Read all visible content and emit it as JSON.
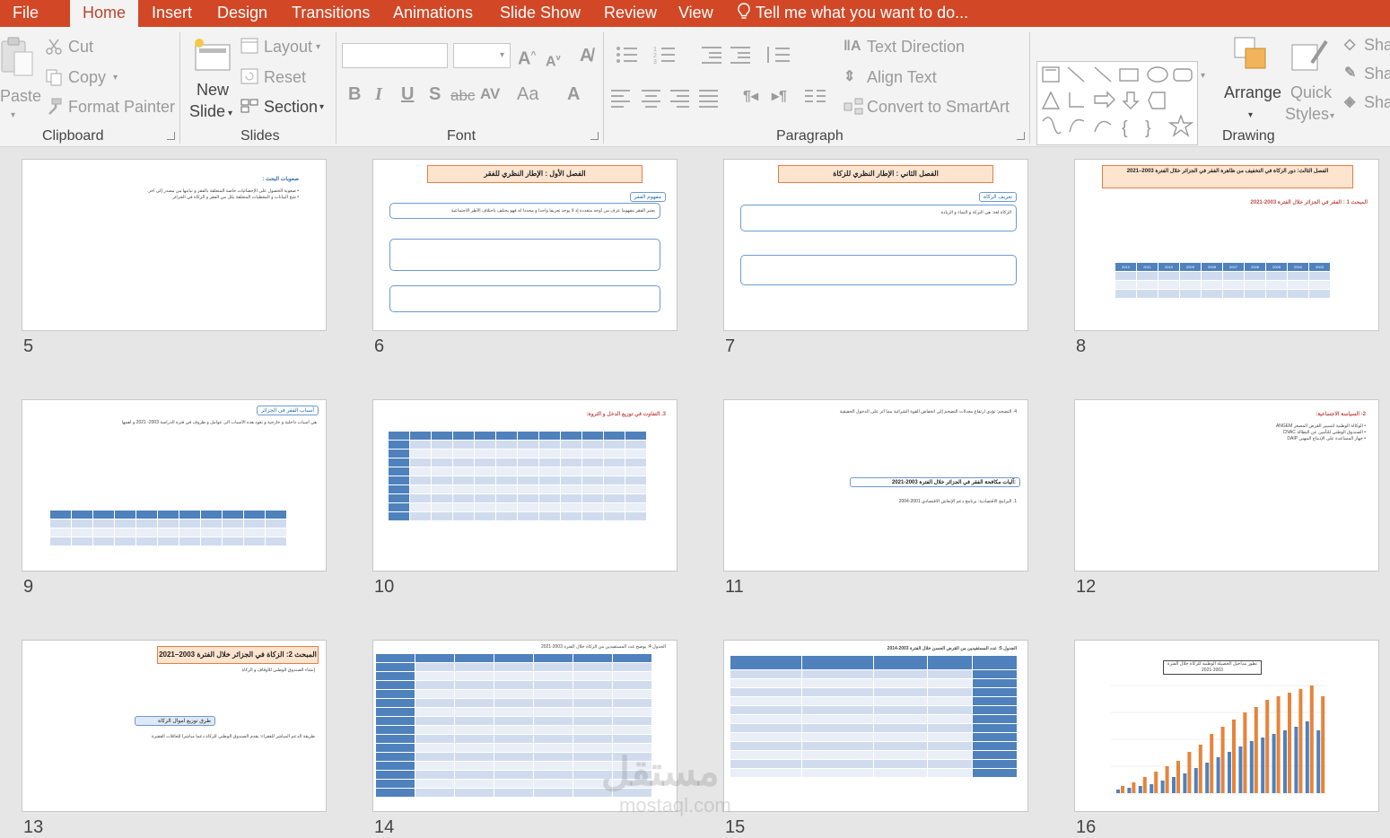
{
  "tabs": [
    "File",
    "Home",
    "Insert",
    "Design",
    "Transitions",
    "Animations",
    "Slide Show",
    "Review",
    "View"
  ],
  "tell_me": "Tell me what you want to do...",
  "clipboard": {
    "paste": "Paste",
    "cut": "Cut",
    "copy": "Copy",
    "format_painter": "Format Painter",
    "label": "Clipboard"
  },
  "slides_group": {
    "new_slide_line1": "New",
    "new_slide_line2": "Slide",
    "layout": "Layout",
    "reset": "Reset",
    "section": "Section",
    "label": "Slides"
  },
  "font_group": {
    "label": "Font"
  },
  "paragraph_group": {
    "text_direction": "Text Direction",
    "align_text": "Align Text",
    "convert_smartart": "Convert to SmartArt",
    "label": "Paragraph"
  },
  "drawing_group": {
    "arrange": "Arrange",
    "quick_styles_line1": "Quick",
    "quick_styles_line2": "Styles",
    "shape_fill": "Sha",
    "shape_outline": "Sha",
    "shape_effects": "Sha",
    "label": "Drawing"
  },
  "slides": [
    {
      "num": "5",
      "title": "",
      "sub": "صعوبات البحث :"
    },
    {
      "num": "6",
      "title": "الفصل الأول : الإطار النظري للفقر",
      "sub": "مفهوم الفقر"
    },
    {
      "num": "7",
      "title": "الفصل الثاني : الإطار النظري للزكاة",
      "sub": "تعريف الزكاة"
    },
    {
      "num": "8",
      "title": "الفصل الثالث: دور الزكاة في التخفيف من ظاهرة الفقر في الجزائر خلال الفترة 2003–2021",
      "sub": "المبحث 1 : الفقر في الجزائر خلال الفترة 2003-2021"
    },
    {
      "num": "9",
      "title": "",
      "sub": "أسباب الفقر في الجزائر"
    },
    {
      "num": "10",
      "title": "",
      "sub": "3. التفاوت في توزيع الدخل و الثروة:"
    },
    {
      "num": "11",
      "title": "",
      "sub": "آليات مكافحة الفقر في الجزائر خلال الفترة 2003-2021:"
    },
    {
      "num": "12",
      "title": "",
      "sub": "2- السياسة الاجتماعية:"
    },
    {
      "num": "13",
      "title": "",
      "sub": "المبحث 2: الزكاة في الجزائر خلال الفترة 2003–2021"
    },
    {
      "num": "14",
      "title": "",
      "sub": "الجدول 4: يوضح عدد المستفيدين من الزكاة خلال الفترة 2003-2021"
    },
    {
      "num": "15",
      "title": "",
      "sub": "الجدول 5: عدد المستفيدين من القرض الحسن خلال الفترة 2003-2014"
    },
    {
      "num": "16",
      "title": "",
      "sub": "تطور مداخيل الحصيلة الوطنية للزكاة خلال الفترة 2003-2021"
    }
  ],
  "table_years": [
    "2012",
    "2011",
    "2010",
    "2009",
    "2008",
    "2007",
    "2006",
    "2005",
    "2004",
    "2003"
  ],
  "watermark": "مستقل",
  "watermark_url": "mostaql.com",
  "colors": {
    "accent": "#d24726",
    "ribbon": "#f3f3f3",
    "sorter": "#e6e6e6"
  }
}
